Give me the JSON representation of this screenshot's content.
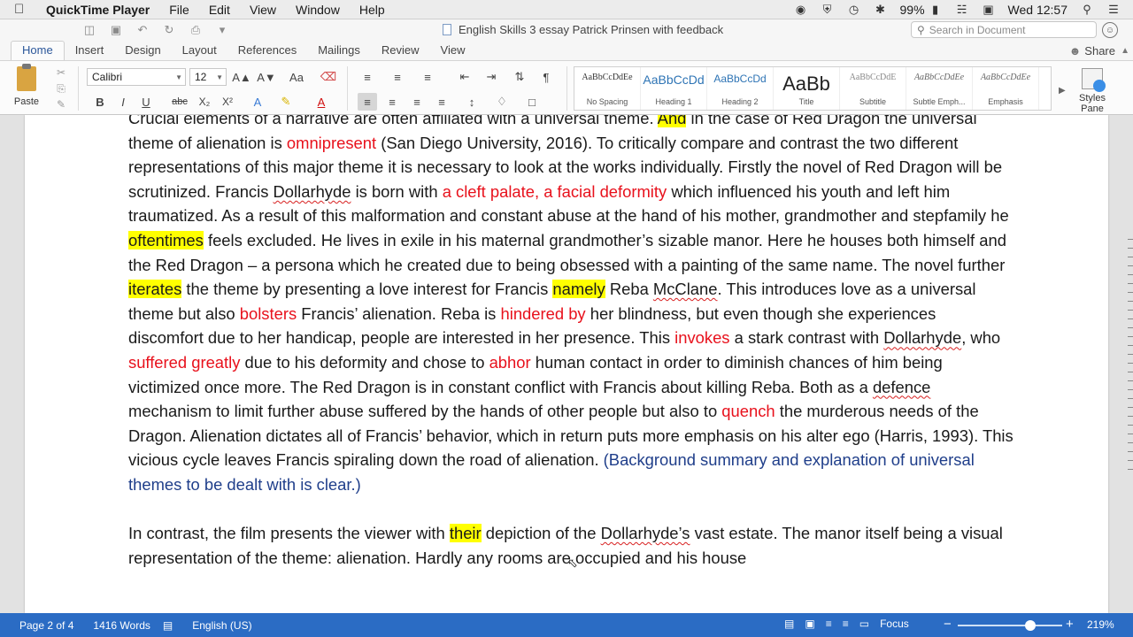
{
  "menubar": {
    "app": "QuickTime Player",
    "items": [
      "File",
      "Edit",
      "View",
      "Window",
      "Help"
    ],
    "battery": "99%",
    "clock": "Wed 12:57"
  },
  "titlebar": {
    "document_title": "English Skills 3 essay Patrick Prinsen with feedback",
    "search_placeholder": "Search in Document"
  },
  "ribbon": {
    "tabs": [
      "Home",
      "Insert",
      "Design",
      "Layout",
      "References",
      "Mailings",
      "Review",
      "View"
    ],
    "share": "Share",
    "paste": "Paste",
    "font": "Calibri",
    "size": "12",
    "styles": [
      {
        "sample": "AaBbCcDdEe",
        "name": "No Spacing"
      },
      {
        "sample": "AaBbCcDd",
        "name": "Heading 1"
      },
      {
        "sample": "AaBbCcDd",
        "name": "Heading 2"
      },
      {
        "sample": "AaBb",
        "name": "Title"
      },
      {
        "sample": "AaBbCcDdE",
        "name": "Subtitle"
      },
      {
        "sample": "AaBbCcDdEe",
        "name": "Subtle Emph..."
      },
      {
        "sample": "AaBbCcDdEe",
        "name": "Emphasis"
      }
    ],
    "styles_pane": "Styles Pane"
  },
  "document": {
    "p1": [
      {
        "t": "Crucial elements of a narrative are often affiliated with a universal theme. "
      },
      {
        "t": "And",
        "c": "hl"
      },
      {
        "t": " in the case of Red Dragon the universal theme of alienation is "
      },
      {
        "t": "omnipresent",
        "c": "red"
      },
      {
        "t": " (San Diego University, 2016). To critically compare and contrast the two different representations of this major theme it is necessary to look at the works individually. Firstly the novel of Red Dragon will be scrutinized. Francis "
      },
      {
        "t": "Dollarhyde",
        "c": "sq"
      },
      {
        "t": " is born with "
      },
      {
        "t": "a cleft palate, a facial deformity",
        "c": "red"
      },
      {
        "t": " which influenced his youth and left him traumatized. As a result of this malformation and constant abuse at the hand of his mother, grandmother and stepfamily he "
      },
      {
        "t": "oftentimes",
        "c": "hl"
      },
      {
        "t": " feels excluded. He lives in exile in his maternal grandmother’s sizable manor. Here he houses both himself and the Red Dragon – a persona which he created due to being obsessed with a painting of the same name. The novel further "
      },
      {
        "t": "iterates",
        "c": "hl"
      },
      {
        "t": " the theme by presenting a love interest for Francis "
      },
      {
        "t": "namely",
        "c": "hl"
      },
      {
        "t": " Reba "
      },
      {
        "t": "McClane",
        "c": "sq"
      },
      {
        "t": ". This introduces love as a universal theme but also "
      },
      {
        "t": "bolsters",
        "c": "red"
      },
      {
        "t": " Francis’ alienation. Reba is "
      },
      {
        "t": "hindered by",
        "c": "red"
      },
      {
        "t": " her blindness, but even though she experiences discomfort due to her handicap, people are interested in her presence. This "
      },
      {
        "t": "invokes",
        "c": "red"
      },
      {
        "t": " a stark contrast with "
      },
      {
        "t": "Dollarhyde",
        "c": "sq"
      },
      {
        "t": ", who "
      },
      {
        "t": "suffered greatly",
        "c": "red"
      },
      {
        "t": " due to his deformity and chose to "
      },
      {
        "t": "abhor",
        "c": "red"
      },
      {
        "t": " human contact in order to diminish chances of him being victimized once more. The Red Dragon is in constant conflict with Francis about killing Reba. Both as a "
      },
      {
        "t": "defence",
        "c": "sq"
      },
      {
        "t": " mechanism to limit further abuse suffered by the hands of other people but also to "
      },
      {
        "t": "quench",
        "c": "red"
      },
      {
        "t": " the murderous needs of the Dragon. Alienation dictates all of Francis’ behavior, which in return puts more emphasis on his alter ego (Harris, 1993). This vicious cycle leaves Francis spiraling down the road of alienation. "
      },
      {
        "t": "(Background summary and explanation of universal themes to be dealt with is clear.)",
        "c": "blue"
      }
    ],
    "p2": [
      {
        "t": "In contrast, the film presents the viewer with "
      },
      {
        "t": "their",
        "c": "hl"
      },
      {
        "t": " depiction of the "
      },
      {
        "t": "Dollarhyde’s",
        "c": "sq"
      },
      {
        "t": " vast estate. The manor itself being a visual representation of the theme: alienation. Hardly any rooms are occupied and his house"
      }
    ]
  },
  "statusbar": {
    "page": "Page 2 of 4",
    "words": "1416 Words",
    "language": "English (US)",
    "focus": "Focus",
    "zoom": "219%"
  },
  "colors": {
    "statusbar": "#2b6cc4",
    "highlight": "#ffff00",
    "red_text": "#e8111c",
    "blue_comment": "#1f3e8a"
  }
}
